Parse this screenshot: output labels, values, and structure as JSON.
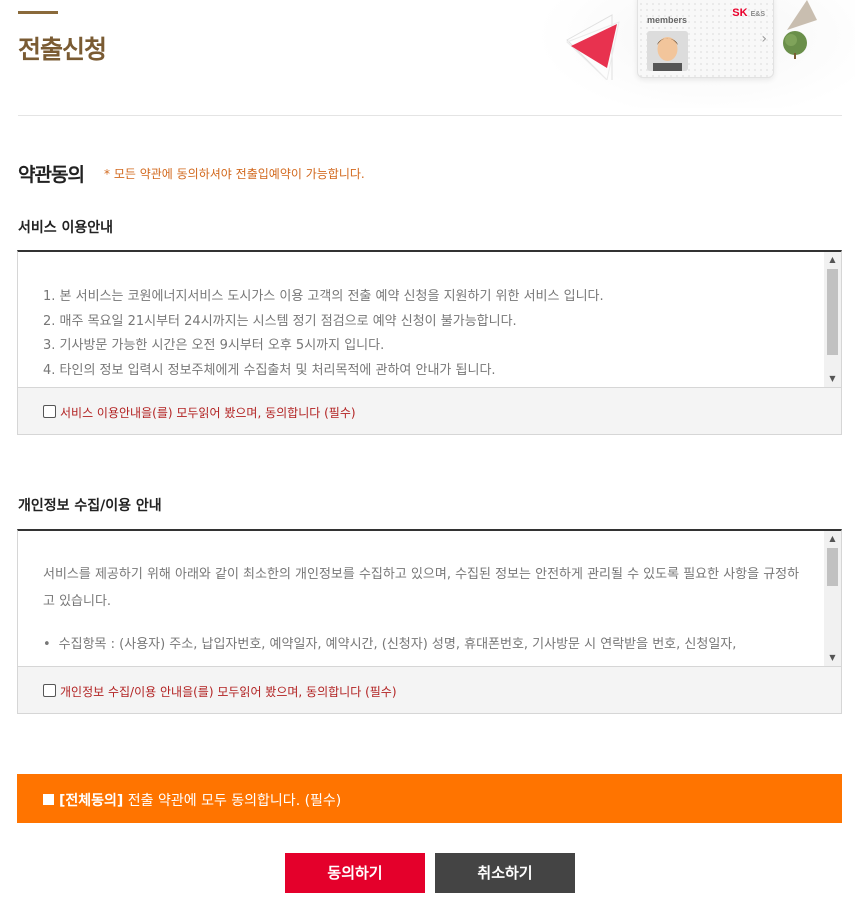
{
  "header": {
    "title": "전출신청",
    "banner": {
      "card_label": "members",
      "brand": "SK",
      "brand_sub": "E&S"
    }
  },
  "agreement": {
    "title": "약관동의",
    "note": "* 모든 약관에 동의하셔야 전출입예약이 가능합니다."
  },
  "service_terms": {
    "title": "서비스 이용안내",
    "lines": [
      "1. 본 서비스는 코원에너지서비스 도시가스 이용 고객의 전출 예약 신청을 지원하기 위한 서비스 입니다.",
      "2. 매주 목요일 21시부터 24시까지는 시스템 정기 점검으로 예약 신청이 불가능합니다.",
      "3. 기사방문 가능한 시간은 오전 9시부터 오후 5시까지 입니다.",
      "4. 타인의 정보 입력시 정보주체에게 수집출처 및 처리목적에 관하여 안내가 됩니다."
    ],
    "checkbox_label": "서비스 이용안내을(를) 모두읽어 봤으며, 동의합니다 (필수)"
  },
  "privacy_terms": {
    "title": "개인정보 수집/이용 안내",
    "intro": "서비스를 제공하기 위해 아래와 같이 최소한의 개인정보를 수집하고 있으며, 수집된 정보는 안전하게 관리될 수 있도록 필요한 사항을 규정하고 있습니다.",
    "bullet": "수집항목 : (사용자) 주소, 납입자번호, 예약일자, 예약시간, (신청자) 성명, 휴대폰번호, 기사방문 시 연락받을 번호, 신청일자,",
    "checkbox_label": "개인정보 수집/이용 안내을(를) 모두읽어 봤으며, 동의합니다 (필수)"
  },
  "all_agree": {
    "bold": "[전체동의]",
    "text": " 전출 약관에 모두 동의합니다. (필수)"
  },
  "buttons": {
    "agree": "동의하기",
    "cancel": "취소하기"
  },
  "colors": {
    "title": "#7a5b33",
    "orange": "#ff7400",
    "red_button": "#e4002b",
    "dark_button": "#444444"
  }
}
